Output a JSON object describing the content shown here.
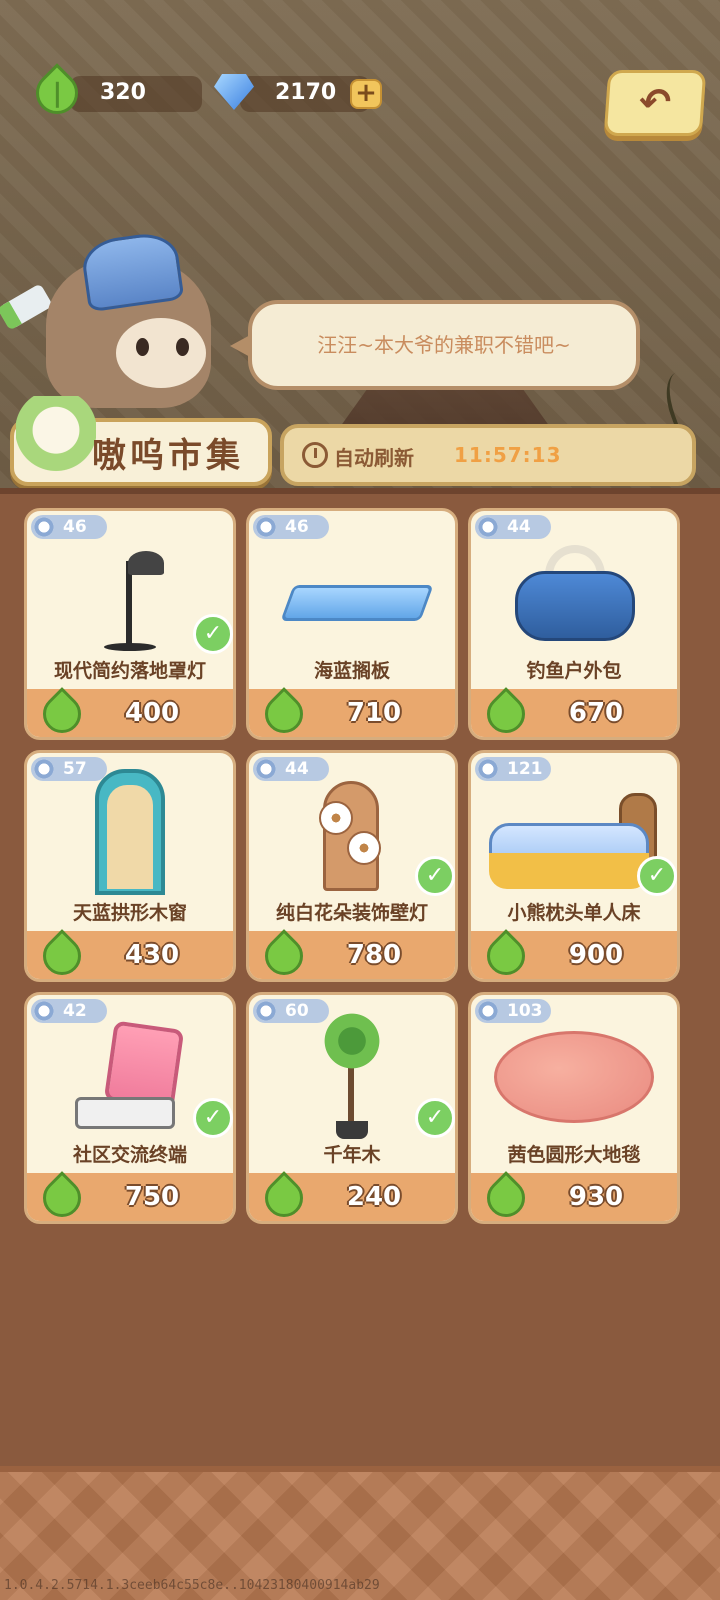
{
  "currency": {
    "leaf_amount": "320",
    "gem_amount": "2170",
    "plus_label": "+"
  },
  "back_button": {
    "label": "↶"
  },
  "speech": {
    "text": "汪汪~本大爷的兼职不错吧~"
  },
  "market": {
    "title": "嗷呜市集",
    "refresh_label": "自动刷新",
    "countdown": "11:57:13"
  },
  "items": [
    {
      "level": "46",
      "name": "现代简约落地罩灯",
      "price": "400",
      "owned": true,
      "icon": "floor-lamp-icon"
    },
    {
      "level": "46",
      "name": "海蓝搁板",
      "price": "710",
      "owned": false,
      "icon": "shelf-icon"
    },
    {
      "level": "44",
      "name": "钓鱼户外包",
      "price": "670",
      "owned": false,
      "icon": "bag-icon"
    },
    {
      "level": "57",
      "name": "天蓝拱形木窗",
      "price": "430",
      "owned": false,
      "icon": "window-icon"
    },
    {
      "level": "44",
      "name": "纯白花朵装饰壁灯",
      "price": "780",
      "owned": true,
      "icon": "wall-lamp-icon"
    },
    {
      "level": "121",
      "name": "小熊枕头单人床",
      "price": "900",
      "owned": true,
      "icon": "bed-icon"
    },
    {
      "level": "42",
      "name": "社区交流终端",
      "price": "750",
      "owned": true,
      "icon": "terminal-icon"
    },
    {
      "level": "60",
      "name": "千年木",
      "price": "240",
      "owned": true,
      "icon": "plant-icon"
    },
    {
      "level": "103",
      "name": "茜色圆形大地毯",
      "price": "930",
      "owned": false,
      "icon": "rug-icon"
    }
  ],
  "version": "1.0.4.2.5714.1.3ceeb64c55c8e..10423180400914ab29",
  "colors": {
    "accent_gold": "#f1c55c",
    "panel_brown": "#8a5a3e",
    "owned_check": "#7ccf62",
    "price_bar": "#e9a86e"
  }
}
